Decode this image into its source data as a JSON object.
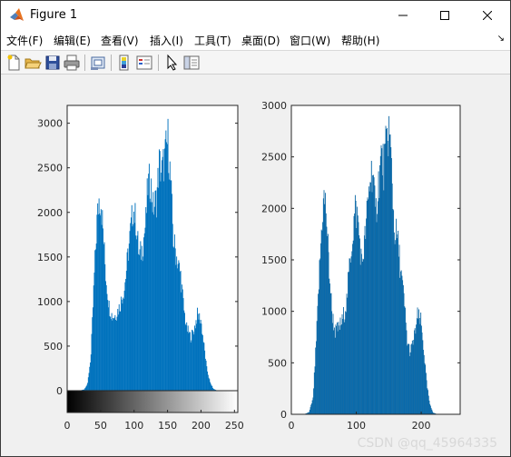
{
  "window": {
    "title": "Figure 1",
    "minimize_icon": "minimize-icon",
    "maximize_icon": "maximize-icon",
    "close_icon": "close-icon"
  },
  "menu": {
    "items": [
      "文件(F)",
      "编辑(E)",
      "查看(V)",
      "插入(I)",
      "工具(T)",
      "桌面(D)",
      "窗口(W)",
      "帮助(H)"
    ],
    "overflow_icon": "chevron-right-icon"
  },
  "toolbar": {
    "buttons": [
      "new-figure-icon",
      "open-file-icon",
      "save-icon",
      "print-icon",
      "link-plot-icon",
      "colorbar-icon",
      "legend-icon",
      "select-pointer-icon",
      "property-inspector-icon"
    ]
  },
  "colors": {
    "bar": "#0072BD",
    "bar_edge": "#005a96",
    "axes_bg": "#ffffff",
    "figure_bg": "#f0f0f0"
  },
  "watermark": "CSDN @qq_45964335",
  "chart_data": [
    {
      "type": "bar",
      "variant": "histogram (imhist) with grayscale colorbar",
      "title": "",
      "xlabel": "",
      "ylabel": "",
      "xlim": [
        0,
        255
      ],
      "ylim": [
        0,
        3200
      ],
      "xticks": [
        0,
        50,
        100,
        150,
        200,
        250
      ],
      "yticks": [
        0,
        500,
        1000,
        1500,
        2000,
        2500,
        3000
      ],
      "grid": false,
      "colorbar": "grayscale 0-255",
      "profile": [
        [
          0,
          0
        ],
        [
          18,
          0
        ],
        [
          25,
          15
        ],
        [
          30,
          80
        ],
        [
          35,
          400
        ],
        [
          40,
          1300
        ],
        [
          44,
          1900
        ],
        [
          47,
          2150
        ],
        [
          50,
          2120
        ],
        [
          53,
          1800
        ],
        [
          57,
          1300
        ],
        [
          62,
          950
        ],
        [
          67,
          830
        ],
        [
          72,
          850
        ],
        [
          78,
          950
        ],
        [
          85,
          1150
        ],
        [
          90,
          1500
        ],
        [
          95,
          1850
        ],
        [
          98,
          2050
        ],
        [
          102,
          1900
        ],
        [
          107,
          1500
        ],
        [
          112,
          1600
        ],
        [
          117,
          1900
        ],
        [
          120,
          2300
        ],
        [
          124,
          2350
        ],
        [
          128,
          2050
        ],
        [
          133,
          2150
        ],
        [
          137,
          2550
        ],
        [
          141,
          2450
        ],
        [
          145,
          2600
        ],
        [
          150,
          2820
        ],
        [
          154,
          2350
        ],
        [
          158,
          1700
        ],
        [
          163,
          1500
        ],
        [
          169,
          1300
        ],
        [
          174,
          900
        ],
        [
          178,
          700
        ],
        [
          184,
          600
        ],
        [
          189,
          680
        ],
        [
          194,
          850
        ],
        [
          199,
          800
        ],
        [
          204,
          500
        ],
        [
          208,
          250
        ],
        [
          213,
          90
        ],
        [
          218,
          20
        ],
        [
          224,
          0
        ],
        [
          255,
          0
        ]
      ]
    },
    {
      "type": "bar",
      "variant": "histogram (bar plot of pixel counts)",
      "title": "",
      "xlabel": "",
      "ylabel": "",
      "xlim": [
        0,
        260
      ],
      "ylim": [
        0,
        3000
      ],
      "xticks": [
        0,
        100,
        200
      ],
      "yticks": [
        0,
        500,
        1000,
        1500,
        2000,
        2500,
        3000
      ],
      "grid": false,
      "profile": [
        [
          0,
          0
        ],
        [
          20,
          0
        ],
        [
          27,
          20
        ],
        [
          33,
          150
        ],
        [
          38,
          700
        ],
        [
          43,
          1400
        ],
        [
          47,
          1900
        ],
        [
          50,
          2100
        ],
        [
          53,
          2000
        ],
        [
          57,
          1500
        ],
        [
          62,
          1000
        ],
        [
          67,
          800
        ],
        [
          72,
          830
        ],
        [
          78,
          900
        ],
        [
          85,
          1100
        ],
        [
          90,
          1500
        ],
        [
          95,
          1800
        ],
        [
          98,
          2000
        ],
        [
          102,
          1900
        ],
        [
          108,
          1450
        ],
        [
          113,
          1700
        ],
        [
          117,
          2000
        ],
        [
          121,
          2300
        ],
        [
          125,
          2400
        ],
        [
          129,
          1900
        ],
        [
          134,
          2250
        ],
        [
          138,
          2500
        ],
        [
          142,
          2400
        ],
        [
          146,
          2600
        ],
        [
          150,
          2780
        ],
        [
          154,
          2400
        ],
        [
          158,
          1800
        ],
        [
          163,
          1700
        ],
        [
          169,
          1350
        ],
        [
          174,
          1050
        ],
        [
          178,
          700
        ],
        [
          183,
          600
        ],
        [
          189,
          750
        ],
        [
          194,
          950
        ],
        [
          199,
          900
        ],
        [
          204,
          600
        ],
        [
          208,
          300
        ],
        [
          213,
          90
        ],
        [
          218,
          15
        ],
        [
          224,
          0
        ],
        [
          260,
          0
        ]
      ]
    }
  ]
}
